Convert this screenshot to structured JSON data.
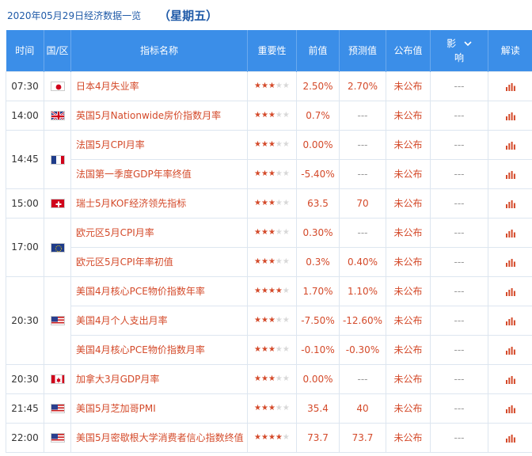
{
  "header": {
    "date": "2020年05月29日经济数据一览",
    "weekday": "（星期五）"
  },
  "columns": {
    "time": "时间",
    "region": "国/区",
    "name": "指标名称",
    "importance": "重要性",
    "previous": "前值",
    "forecast": "预测值",
    "actual": "公布值",
    "impact_top": "影",
    "impact_bottom": "响",
    "analysis": "解读"
  },
  "icons": {
    "chevron": "chevron-down-icon",
    "analysis": "bar-chart-icon"
  },
  "colors": {
    "header_bg": "#3b8ee8",
    "accent_red": "#d44a2a",
    "title_blue": "#1f5aa8"
  },
  "groups": [
    {
      "time": "07:30",
      "rows": [
        {
          "flag": "japan",
          "name": "日本4月失业率",
          "stars": 3,
          "previous": "2.50%",
          "forecast": "2.70%",
          "actual": "未公布",
          "impact": "---"
        }
      ]
    },
    {
      "time": "14:00",
      "rows": [
        {
          "flag": "uk",
          "name": "英国5月Nationwide房价指数月率",
          "stars": 3,
          "previous": "0.7%",
          "forecast": "---",
          "actual": "未公布",
          "impact": "---"
        }
      ]
    },
    {
      "time": "14:45",
      "flag": "france",
      "rows": [
        {
          "name": "法国5月CPI月率",
          "stars": 3,
          "previous": "0.00%",
          "forecast": "---",
          "actual": "未公布",
          "impact": "---"
        },
        {
          "name": "法国第一季度GDP年率终值",
          "stars": 3,
          "previous": "-5.40%",
          "forecast": "---",
          "actual": "未公布",
          "impact": "---"
        }
      ]
    },
    {
      "time": "15:00",
      "rows": [
        {
          "flag": "switzerland",
          "name": "瑞士5月KOF经济领先指标",
          "stars": 3,
          "previous": "63.5",
          "forecast": "70",
          "actual": "未公布",
          "impact": "---"
        }
      ]
    },
    {
      "time": "17:00",
      "flag": "eu",
      "rows": [
        {
          "name": "欧元区5月CPI月率",
          "stars": 3,
          "previous": "0.30%",
          "forecast": "---",
          "actual": "未公布",
          "impact": "---"
        },
        {
          "name": "欧元区5月CPI年率初值",
          "stars": 3,
          "previous": "0.3%",
          "forecast": "0.40%",
          "actual": "未公布",
          "impact": "---"
        }
      ]
    },
    {
      "time": "20:30",
      "flag": "usa",
      "rows": [
        {
          "name": "美国4月核心PCE物价指数年率",
          "stars": 4,
          "previous": "1.70%",
          "forecast": "1.10%",
          "actual": "未公布",
          "impact": "---"
        },
        {
          "name": "美国4月个人支出月率",
          "stars": 3,
          "previous": "-7.50%",
          "forecast": "-12.60%",
          "actual": "未公布",
          "impact": "---"
        },
        {
          "name": "美国4月核心PCE物价指数月率",
          "stars": 3,
          "previous": "-0.10%",
          "forecast": "-0.30%",
          "actual": "未公布",
          "impact": "---"
        }
      ]
    },
    {
      "time": "20:30",
      "rows": [
        {
          "flag": "canada",
          "name": "加拿大3月GDP月率",
          "stars": 3,
          "previous": "0.00%",
          "forecast": "---",
          "actual": "未公布",
          "impact": "---"
        }
      ]
    },
    {
      "time": "21:45",
      "rows": [
        {
          "flag": "usa",
          "name": "美国5月芝加哥PMI",
          "stars": 3,
          "previous": "35.4",
          "forecast": "40",
          "actual": "未公布",
          "impact": "---"
        }
      ]
    },
    {
      "time": "22:00",
      "rows": [
        {
          "flag": "usa",
          "name": "美国5月密歇根大学消费者信心指数终值",
          "stars": 4,
          "previous": "73.7",
          "forecast": "73.7",
          "actual": "未公布",
          "impact": "---"
        }
      ]
    }
  ]
}
